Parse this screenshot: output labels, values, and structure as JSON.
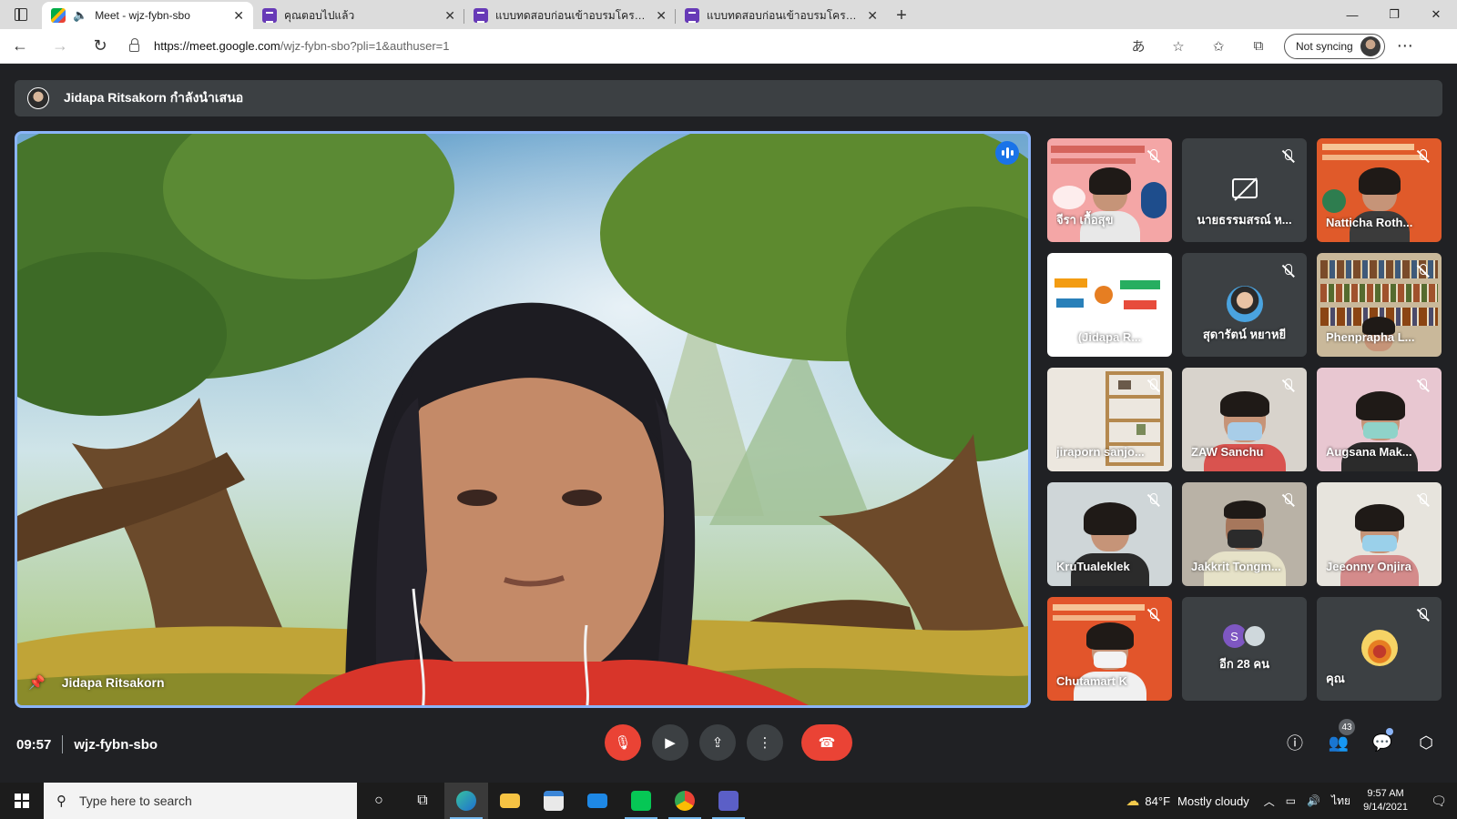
{
  "browser": {
    "tabs": [
      {
        "label": "Meet - wjz-fybn-sbo",
        "icon": "meet-icon",
        "active": true,
        "audio": true
      },
      {
        "label": "คุณตอบไปแล้ว",
        "icon": "forms-icon",
        "active": false
      },
      {
        "label": "แบบทดสอบก่อนเข้าอบรมโครงการ \"อบ",
        "icon": "forms-icon",
        "active": false
      },
      {
        "label": "แบบทดสอบก่อนเข้าอบรมโครงการ \"อบ",
        "icon": "forms-icon",
        "active": false
      }
    ],
    "url_host": "https://meet.google.com",
    "url_path": "/wjz-fybn-sbo?pli=1&authuser=1",
    "sync_label": "Not syncing"
  },
  "presenter": {
    "text": "Jidapa Ritsakorn กำลังนำเสนอ"
  },
  "main_video": {
    "name": "Jidapa Ritsakorn"
  },
  "participants": [
    {
      "name": "จีรา เกื้อสุข",
      "kind": "slide-pink",
      "muted": true
    },
    {
      "name": "นายธรรมสรณ์ ห...",
      "kind": "camoff",
      "muted": true
    },
    {
      "name": "Natticha Roth...",
      "kind": "slide-orange",
      "muted": true
    },
    {
      "name": "(Jidapa R...",
      "kind": "slide-white",
      "muted": true
    },
    {
      "name": "สุดารัตน์ หยาหยี",
      "kind": "avatar",
      "muted": true
    },
    {
      "name": "Phenprapha L...",
      "kind": "bookshelf",
      "muted": true
    },
    {
      "name": "jiraporn sanjo...",
      "kind": "shelf",
      "muted": true
    },
    {
      "name": "ZAW Sanchu",
      "kind": "mask-red",
      "muted": true
    },
    {
      "name": "Augsana Mak...",
      "kind": "mask-pink",
      "muted": true
    },
    {
      "name": "KruTualeklek",
      "kind": "person-dark",
      "muted": true
    },
    {
      "name": "Jakkrit Tongm...",
      "kind": "person-mask",
      "muted": true
    },
    {
      "name": "Jeeonny Onjira",
      "kind": "mask-office",
      "muted": true
    },
    {
      "name": "Chutamart K",
      "kind": "slide-orange2",
      "muted": true
    },
    {
      "name": "อีก 28 คน",
      "kind": "others",
      "muted": false,
      "initial": "S"
    },
    {
      "name": "คุณ",
      "kind": "self",
      "muted": true
    }
  ],
  "controls": {
    "time": "09:57",
    "meeting_code": "wjz-fybn-sbo",
    "people_count": "43"
  },
  "taskbar": {
    "search_placeholder": "Type here to search",
    "weather_temp": "84°F",
    "weather_desc": "Mostly cloudy",
    "lang": "ไทย",
    "time": "9:57 AM",
    "date": "9/14/2021"
  },
  "colors": {
    "meet_bg": "#202124",
    "tile_bg": "#3c4043",
    "end_call": "#ea4335",
    "speaking_border": "#8ab4f8",
    "taskbar": "#1c1c1c"
  }
}
